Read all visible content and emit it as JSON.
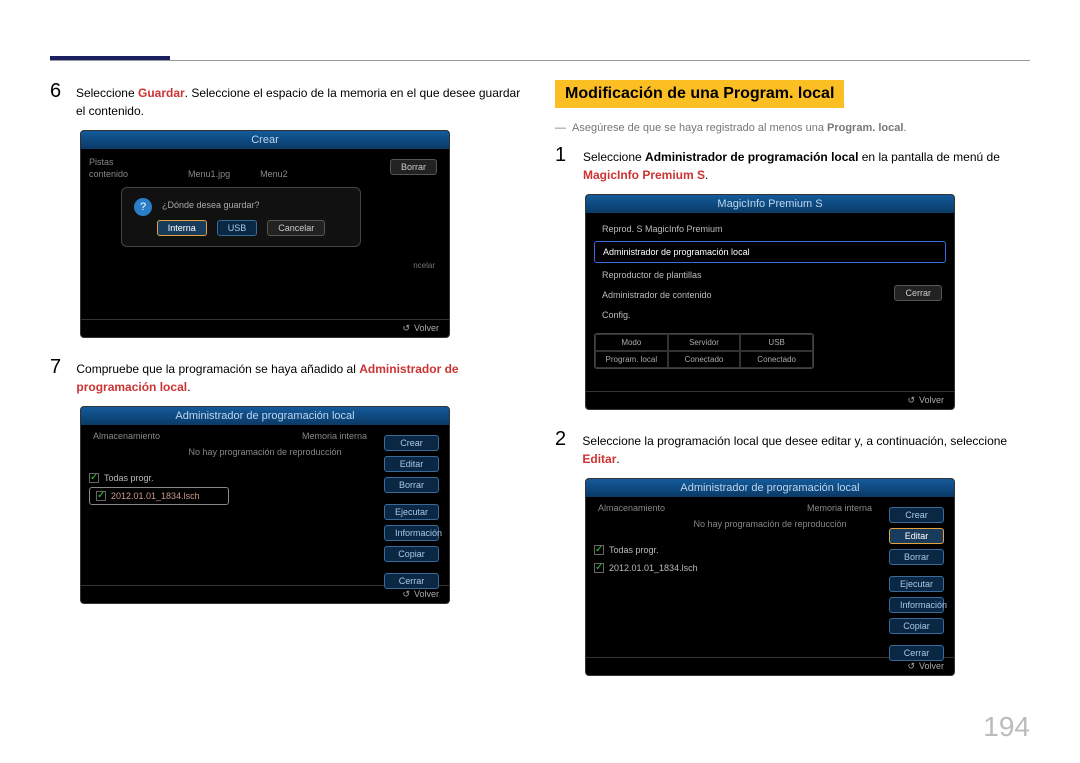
{
  "page_number": "194",
  "left": {
    "step6": {
      "num": "6",
      "pre": "Seleccione ",
      "bold": "Guardar",
      "post": ". Seleccione el espacio de la memoria en el que desee guardar el contenido."
    },
    "panel_crear": {
      "title": "Crear",
      "row_pistas": "Pistas",
      "row_contenido": "contenido",
      "file1": "Menu1.jpg",
      "file2": "Menu2",
      "top_btn": "Borrar",
      "overlay_q": "¿Dónde desea guardar?",
      "btn_interna": "Interna",
      "btn_usb": "USB",
      "btn_cancelar": "Cancelar",
      "hidden": "ncelar",
      "footer": "Volver"
    },
    "step7": {
      "num": "7",
      "pre": "Compruebe que la programación se haya añadido al ",
      "bold": "Administrador de programación local",
      "post": "."
    },
    "panel_admin": {
      "title": "Administrador de programación local",
      "top_l": "Almacenamiento",
      "top_r": "Memoria interna",
      "msg": "No hay programación de reproducción",
      "chk_label": "Todas progr.",
      "row1": "2012.01.01_1834.lsch",
      "btns": [
        "Crear",
        "Editar",
        "Borrar",
        "Ejecutar",
        "Información",
        "Copiar",
        "Cerrar"
      ],
      "footer": "Volver"
    }
  },
  "right": {
    "heading": "Modificación de una Program. local",
    "dash": "―",
    "note_pre": "Asegúrese de que se haya registrado al menos una ",
    "note_bold": "Program. local",
    "note_post": ".",
    "step1": {
      "num": "1",
      "pre": "Seleccione ",
      "bold": "Administrador de programación local",
      "mid": " en la pantalla de menú de ",
      "bold2": "MagicInfo Premium S",
      "post": "."
    },
    "panel_magic": {
      "title": "MagicInfo Premium S",
      "items": [
        "Reprod. S MagicInfo Premium",
        "Administrador de programación local",
        "Reproductor de plantillas",
        "Administrador de contenido",
        "Config."
      ],
      "btn_cerrar": "Cerrar",
      "tbl_h": [
        "Modo",
        "Servidor",
        "USB"
      ],
      "tbl_r": [
        "Program. local",
        "Conectado",
        "Conectado"
      ],
      "footer": "Volver"
    },
    "step2": {
      "num": "2",
      "pre": "Seleccione la programación local que desee editar y, a continuación, seleccione ",
      "bold": "Editar",
      "post": "."
    },
    "panel_admin2": {
      "title": "Administrador de programación local",
      "top_l": "Almacenamiento",
      "top_r": "Memoria interna",
      "msg": "No hay programación de reproducción",
      "chk_label": "Todas progr.",
      "row1": "2012.01.01_1834.lsch",
      "btns": [
        "Crear",
        "Editar",
        "Borrar",
        "Ejecutar",
        "Información",
        "Copiar",
        "Cerrar"
      ],
      "footer": "Volver"
    }
  }
}
